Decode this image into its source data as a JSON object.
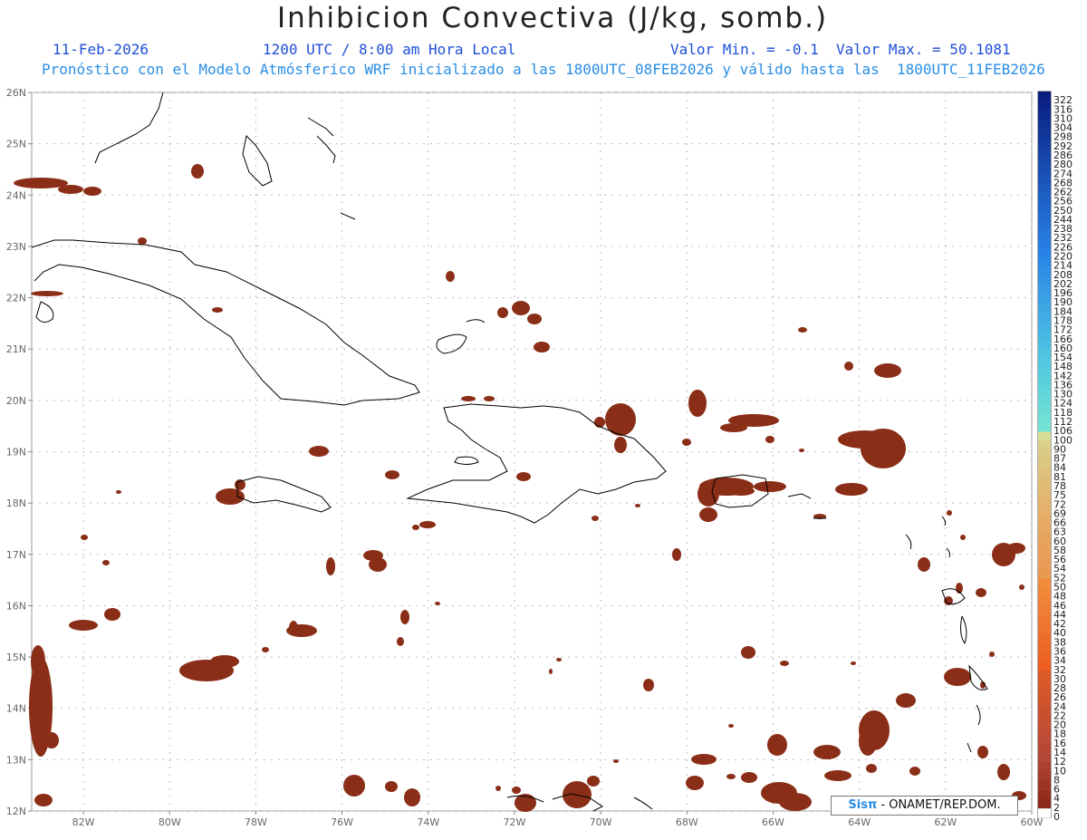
{
  "title": "Inhibicion Convectiva (J/kg, somb.)",
  "header": {
    "date": "11-Feb-2026",
    "time": "1200 UTC / 8:00 am Hora Local",
    "minmax": "Valor Min. = -0.1  Valor Max. = 50.1081",
    "model_info": "Pronóstico con el Modelo Atmósferico WRF inicializado a las 1800UTC_08FEB2026 y válido hasta las  1800UTC_11FEB2026"
  },
  "map": {
    "lon_labels": [
      "82W",
      "80W",
      "78W",
      "76W",
      "74W",
      "72W",
      "70W",
      "68W",
      "66W",
      "64W",
      "62W",
      "60W"
    ],
    "lat_labels": [
      "12N",
      "13N",
      "14N",
      "15N",
      "16N",
      "17N",
      "18N",
      "19N",
      "20N",
      "21N",
      "22N",
      "23N",
      "24N",
      "25N",
      "26N"
    ],
    "lon_range": [
      -83.2,
      -60.0
    ],
    "lat_range": [
      12.0,
      26.0
    ],
    "field_color": "#8a2e17",
    "coast_color": "#000000",
    "grid": true
  },
  "colorbar": {
    "labels": [
      "0",
      "2",
      "4",
      "6",
      "8",
      "10",
      "12",
      "14",
      "16",
      "18",
      "20",
      "22",
      "24",
      "26",
      "28",
      "30",
      "32",
      "34",
      "36",
      "38",
      "40",
      "42",
      "44",
      "46",
      "48",
      "50",
      "52",
      "54",
      "56",
      "58",
      "60",
      "63",
      "66",
      "69",
      "72",
      "75",
      "78",
      "81",
      "84",
      "87",
      "90",
      "100",
      "106",
      "112",
      "118",
      "124",
      "130",
      "136",
      "142",
      "148",
      "154",
      "160",
      "166",
      "172",
      "178",
      "184",
      "190",
      "196",
      "202",
      "208",
      "214",
      "220",
      "226",
      "232",
      "238",
      "244",
      "250",
      "256",
      "262",
      "268",
      "274",
      "280",
      "286",
      "292",
      "298",
      "304",
      "310",
      "316",
      "322"
    ]
  },
  "credit": {
    "logo": "Sisπ",
    "text": " - ONAMET/REP.DOM."
  }
}
